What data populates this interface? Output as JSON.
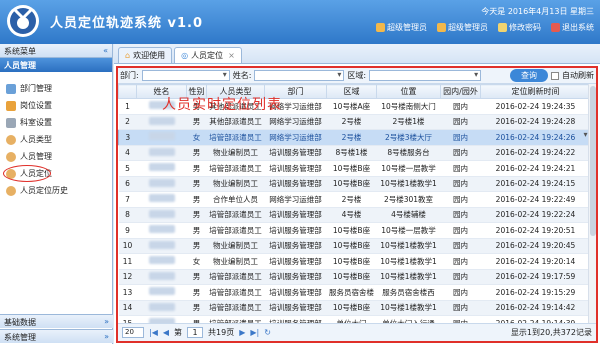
{
  "header": {
    "title": "人员定位轨迹系统 v1.0",
    "date": "今天是 2016年4月13日 星期三",
    "toolbar": [
      "超级管理员",
      "超级管理员",
      "修改密码",
      "退出系统"
    ],
    "brand_color": "#2f78c9"
  },
  "sidebar": {
    "title": "系统菜单",
    "collapse": "«",
    "group": "人员管理",
    "items": [
      "部门管理",
      "岗位设置",
      "科室设置",
      "人员类型",
      "人员管理",
      "人员定位",
      "人员定位历史"
    ],
    "footer": [
      "基础数据",
      "系统管理"
    ]
  },
  "tabs": [
    {
      "label": "欢迎使用",
      "icon": "home-icon"
    },
    {
      "label": "人员定位",
      "icon": "location-icon"
    }
  ],
  "filter": {
    "dept_label": "部门:",
    "name_label": "姓名:",
    "region_label": "区域:",
    "query": "查询",
    "auto_refresh": "自动刷新"
  },
  "overlay_title": "人员实时定位列表",
  "table": {
    "columns": [
      "",
      "姓名",
      "性别",
      "人员类型",
      "部门",
      "区域",
      "位置",
      "园内/园外",
      "定位刷新时间"
    ],
    "rows": [
      [
        "1",
        "",
        "男",
        "其他部派遣员工",
        "网络学习运维部",
        "10号楼A座",
        "10号楼南侧大门",
        "园内",
        "2016-02-24 19:24:35"
      ],
      [
        "2",
        "",
        "男",
        "其他部派遣员工",
        "网络学习运维部",
        "2号楼",
        "2号楼1楼",
        "园内",
        "2016-02-24 19:24:28"
      ],
      [
        "3",
        "",
        "女",
        "培管部派遣员工",
        "网络学习运维部",
        "2号楼",
        "2号楼3楼大厅",
        "园内",
        "2016-02-24 19:24:26"
      ],
      [
        "4",
        "",
        "男",
        "物业编制员工",
        "培训服务管理部",
        "8号楼1楼",
        "8号楼服务台",
        "园内",
        "2016-02-24 19:24:22"
      ],
      [
        "5",
        "",
        "男",
        "培管部派遣员工",
        "培训服务管理部",
        "10号楼B座",
        "10号楼一层教学",
        "园内",
        "2016-02-24 19:24:21"
      ],
      [
        "6",
        "",
        "男",
        "物业编制员工",
        "培训服务管理部",
        "10号楼B座",
        "10号楼1楼教学1",
        "园内",
        "2016-02-24 19:24:15"
      ],
      [
        "7",
        "",
        "男",
        "合作单位人员",
        "网络学习运维部",
        "2号楼",
        "2号楼301教室",
        "园内",
        "2016-02-24 19:22:49"
      ],
      [
        "8",
        "",
        "男",
        "培管部派遣员工",
        "培训服务管理部",
        "4号楼",
        "4号楼辅楼",
        "园内",
        "2016-02-24 19:22:24"
      ],
      [
        "9",
        "",
        "男",
        "培管部派遣员工",
        "培训服务管理部",
        "10号楼B座",
        "10号楼一层教学",
        "园内",
        "2016-02-24 19:20:51"
      ],
      [
        "10",
        "",
        "男",
        "物业编制员工",
        "培训服务管理部",
        "10号楼B座",
        "10号楼1楼教学1",
        "园内",
        "2016-02-24 19:20:45"
      ],
      [
        "11",
        "",
        "女",
        "物业编制员工",
        "培训服务管理部",
        "10号楼B座",
        "10号楼1楼教学1",
        "园内",
        "2016-02-24 19:20:14"
      ],
      [
        "12",
        "",
        "男",
        "培管部派遣员工",
        "培训服务管理部",
        "10号楼B座",
        "10号楼1楼教学1",
        "园内",
        "2016-02-24 19:17:59"
      ],
      [
        "13",
        "",
        "男",
        "培管部派遣员工",
        "培训服务管理部",
        "服务员宿舍楼",
        "服务员宿舍楼西",
        "园内",
        "2016-02-24 19:15:29"
      ],
      [
        "14",
        "",
        "男",
        "培管部派遣员工",
        "培训服务管理部",
        "10号楼B座",
        "10号楼1楼教学1",
        "园内",
        "2016-02-24 19:14:42"
      ],
      [
        "15",
        "",
        "男",
        "培管部派遣员工",
        "培训服务管理部",
        "单位大门",
        "单位大门入行通",
        "园内",
        "2016-02-24 19:14:39"
      ]
    ]
  },
  "pager": {
    "page_size": "20",
    "page_label": "第",
    "page": "1",
    "total_pages": "共19页",
    "info": "显示1到20,共372记录"
  }
}
